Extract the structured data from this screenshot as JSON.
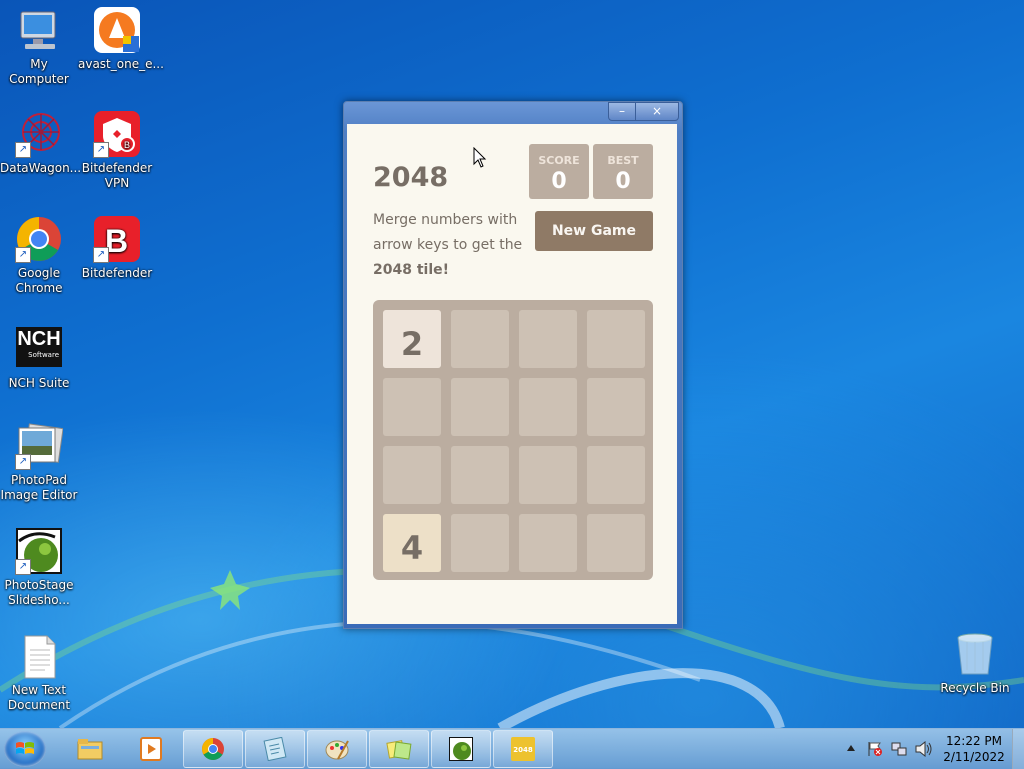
{
  "desktop": {
    "icons": [
      {
        "label": "My Computer",
        "icon": "computer-icon"
      },
      {
        "label": "avast_one_e...",
        "icon": "avast-icon"
      },
      {
        "label": "DataWagon...",
        "icon": "datawagon-icon"
      },
      {
        "label": "Bitdefender VPN",
        "icon": "bitdefender-vpn-icon"
      },
      {
        "label": "Google Chrome",
        "icon": "chrome-icon"
      },
      {
        "label": "Bitdefender",
        "icon": "bitdefender-icon"
      },
      {
        "label": "NCH Suite",
        "icon": "nch-icon"
      },
      {
        "label": "PhotoPad Image Editor",
        "icon": "photopad-icon"
      },
      {
        "label": "PhotoStage Slidesho...",
        "icon": "photostage-icon"
      },
      {
        "label": "New Text Document",
        "icon": "text-document-icon"
      },
      {
        "label": "Recycle Bin",
        "icon": "recycle-bin-icon"
      }
    ],
    "nch_text": "NCH",
    "nch_sub": "Software"
  },
  "window": {
    "minimize_glyph": "–",
    "close_glyph": "×"
  },
  "game": {
    "title": "2048",
    "score_label": "SCORE",
    "score": "0",
    "best_label": "BEST",
    "best": "0",
    "intro_text": "Merge numbers with arrow keys to get the ",
    "intro_bold": "2048 tile!",
    "new_game_label": "New Game",
    "tiles": [
      {
        "value": "2",
        "row": 0,
        "col": 0,
        "color": "#eee4da"
      },
      {
        "value": "4",
        "row": 3,
        "col": 0,
        "color": "#ede0c8"
      }
    ]
  },
  "taskbar": {
    "apps": [
      {
        "name": "file-explorer-icon"
      },
      {
        "name": "media-player-icon"
      },
      {
        "name": "chrome-icon"
      },
      {
        "name": "notepad-icon"
      },
      {
        "name": "paint-icon"
      },
      {
        "name": "sticky-notes-icon"
      },
      {
        "name": "photostage-icon"
      },
      {
        "name": "2048-icon",
        "label": "2048"
      }
    ],
    "clock_time": "12:22 PM",
    "clock_date": "2/11/2022"
  },
  "colors": {
    "board": "#bbada0",
    "empty_cell": "#cdc1b4",
    "text": "#776e65",
    "button": "#8f7a66"
  }
}
